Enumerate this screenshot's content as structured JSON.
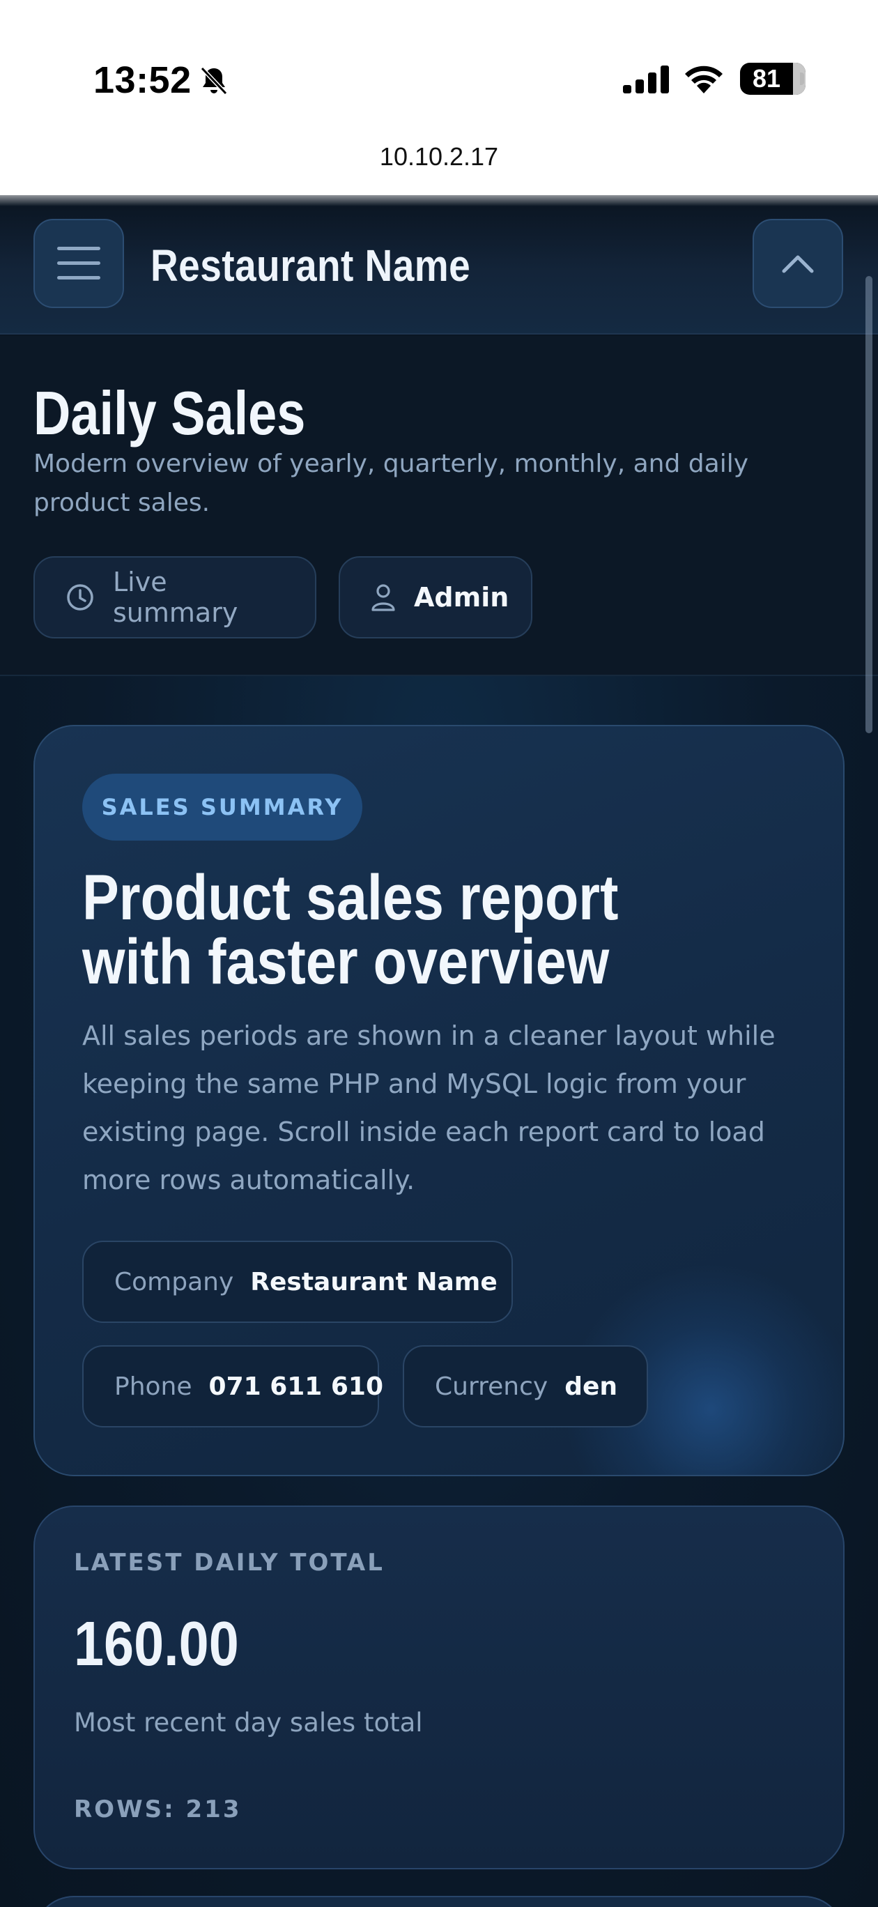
{
  "status_bar": {
    "time": "13:52",
    "battery": "81",
    "url": "10.10.2.17"
  },
  "header": {
    "title": "Restaurant Name"
  },
  "page": {
    "title": "Daily Sales",
    "subtitle": "Modern overview of yearly, quarterly, monthly, and daily product sales.",
    "chips": {
      "live": "Live summary",
      "user": "Admin"
    }
  },
  "hero": {
    "label": "SALES SUMMARY",
    "title_line1": "Product sales report",
    "title_line2": "with faster overview",
    "description": "All sales periods are shown in a cleaner layout while keeping the same PHP and MySQL logic from your existing page. Scroll inside each report card to load more rows automatically.",
    "company_key": "Company",
    "company_value": "Restaurant Name",
    "phone_key": "Phone",
    "phone_value": "071 611 610",
    "currency_key": "Currency",
    "currency_value": "den"
  },
  "stat": {
    "label": "LATEST DAILY TOTAL",
    "value": "160.00",
    "note": "Most recent day sales total",
    "rows": "ROWS: 213"
  },
  "colors": {
    "background": "#0a1522",
    "accent": "#8cc2f4",
    "card": "#142b47"
  },
  "icons": [
    "bell-slash-icon",
    "signal-icon",
    "wifi-icon",
    "battery-icon",
    "menu-icon",
    "chevron-up-icon",
    "clock-icon",
    "user-icon"
  ]
}
